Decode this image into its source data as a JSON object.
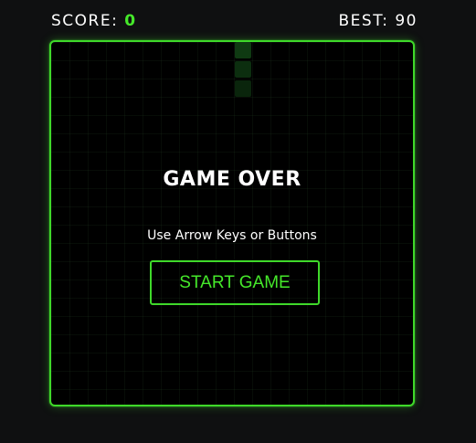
{
  "hud": {
    "score_label": "SCORE:",
    "score_value": "0",
    "best_label": "BEST:",
    "best_value": "90"
  },
  "overlay": {
    "title": "GAME OVER",
    "instructions": "Use Arrow Keys or Buttons",
    "start_button_label": "START GAME"
  },
  "colors": {
    "accent": "#3fd92a",
    "background": "#0f1011",
    "board": "#000000"
  }
}
